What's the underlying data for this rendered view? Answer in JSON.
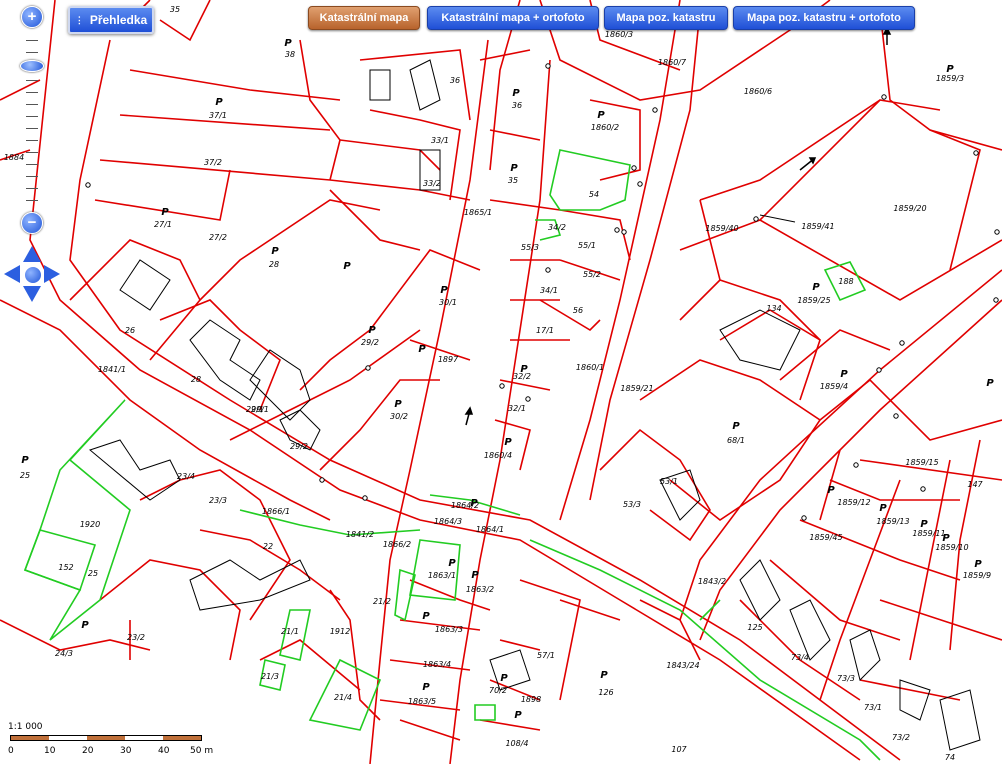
{
  "toolbar": {
    "overview_label": "Přehledka",
    "buttons": [
      {
        "label": "Katastrální mapa",
        "active": true
      },
      {
        "label": "Katastrální mapa + ortofoto",
        "active": false
      },
      {
        "label": "Mapa poz. katastru",
        "active": false
      },
      {
        "label": "Mapa poz. katastru + ortofoto",
        "active": false
      }
    ]
  },
  "zoom": {
    "in_label": "+",
    "out_label": "−"
  },
  "scale": {
    "ratio": "1:1 000",
    "ticks": [
      "0",
      "10",
      "20",
      "30",
      "40",
      "50 m"
    ]
  },
  "colors": {
    "parcel_line": "#e00000",
    "building_line": "#22cc22",
    "active_button": "#c0703a",
    "button": "#2457e0"
  },
  "parcels": [
    "35",
    "38",
    "37/1",
    "37/2",
    "27/1",
    "27/2",
    "28",
    "26",
    "29/1",
    "29/2",
    "28",
    "29/1",
    "29/2",
    "36",
    "36",
    "33/1",
    "33/2",
    "35",
    "54",
    "1865/1",
    "34/2",
    "55/1",
    "55/3",
    "55/2",
    "34/1",
    "56",
    "17/1",
    "32/2",
    "32/1",
    "1860/4",
    "30/1",
    "1897",
    "30/2",
    "1860/3",
    "1860/2",
    "1860/7",
    "1860/6",
    "1860/1",
    "1859/3",
    "1859/20",
    "1859/40",
    "1859/41",
    "1859/25",
    "134",
    "188",
    "1859/21",
    "1859/4",
    "68/1",
    "53/1",
    "53/3",
    "1859/15",
    "1859/12",
    "1859/13",
    "1859/11",
    "1859/10",
    "1859/9",
    "147",
    "1864/2",
    "1864/3",
    "1864/1",
    "1866/1",
    "1866/2",
    "1841/1",
    "1841/2",
    "22",
    "21/2",
    "1863/1",
    "1863/2",
    "1863/3",
    "1863/4",
    "1863/5",
    "21/1",
    "21/3",
    "21/4",
    "1912",
    "25",
    "23/4",
    "23/3",
    "1920",
    "152",
    "25",
    "23/2",
    "24/3",
    "57/1",
    "70/2",
    "1898",
    "126",
    "108/4",
    "107",
    "125",
    "73/4",
    "73/3",
    "73/1",
    "73/2",
    "74",
    "1843/2",
    "1843/24",
    "1859/45",
    "1884"
  ],
  "symbol": "P"
}
